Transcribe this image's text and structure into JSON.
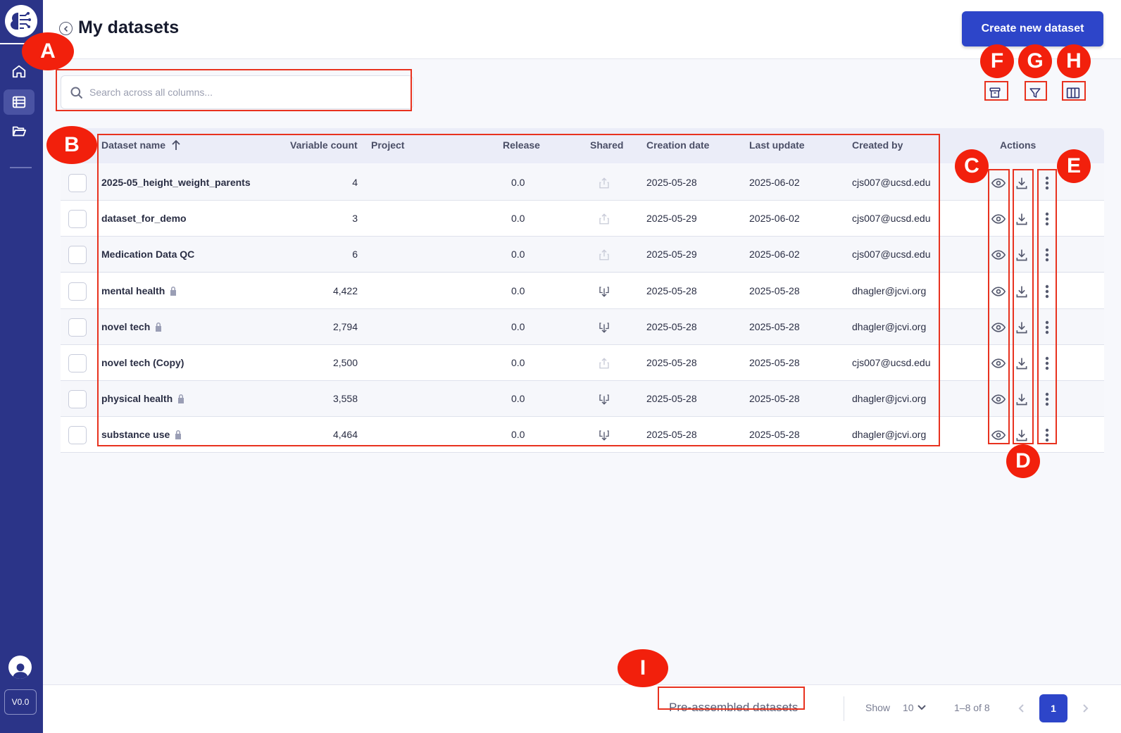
{
  "header": {
    "title": "My datasets",
    "create_label": "Create new dataset"
  },
  "sidebar": {
    "version": "V0.0"
  },
  "search": {
    "placeholder": "Search across all columns..."
  },
  "table": {
    "columns": [
      "Dataset name",
      "Variable count",
      "Project",
      "Release",
      "Shared",
      "Creation date",
      "Last update",
      "Created by",
      "Actions"
    ],
    "rows": [
      {
        "name": "2025-05_height_weight_parents",
        "locked": false,
        "count": "4",
        "project": "",
        "release": "0.0",
        "shared": "share",
        "created": "2025-05-28",
        "updated": "2025-06-02",
        "by": "cjs007@ucsd.edu"
      },
      {
        "name": "dataset_for_demo",
        "locked": false,
        "count": "3",
        "project": "",
        "release": "0.0",
        "shared": "share",
        "created": "2025-05-29",
        "updated": "2025-06-02",
        "by": "cjs007@ucsd.edu"
      },
      {
        "name": "Medication Data QC",
        "locked": false,
        "count": "6",
        "project": "",
        "release": "0.0",
        "shared": "share",
        "created": "2025-05-29",
        "updated": "2025-06-02",
        "by": "cjs007@ucsd.edu"
      },
      {
        "name": "mental health",
        "locked": true,
        "count": "4,422",
        "project": "",
        "release": "0.0",
        "shared": "received",
        "created": "2025-05-28",
        "updated": "2025-05-28",
        "by": "dhagler@jcvi.org"
      },
      {
        "name": "novel tech",
        "locked": true,
        "count": "2,794",
        "project": "",
        "release": "0.0",
        "shared": "received",
        "created": "2025-05-28",
        "updated": "2025-05-28",
        "by": "dhagler@jcvi.org"
      },
      {
        "name": "novel tech (Copy)",
        "locked": false,
        "count": "2,500",
        "project": "",
        "release": "0.0",
        "shared": "share",
        "created": "2025-05-28",
        "updated": "2025-05-28",
        "by": "cjs007@ucsd.edu"
      },
      {
        "name": "physical health",
        "locked": true,
        "count": "3,558",
        "project": "",
        "release": "0.0",
        "shared": "received",
        "created": "2025-05-28",
        "updated": "2025-05-28",
        "by": "dhagler@jcvi.org"
      },
      {
        "name": "substance use",
        "locked": true,
        "count": "4,464",
        "project": "",
        "release": "0.0",
        "shared": "received",
        "created": "2025-05-28",
        "updated": "2025-05-28",
        "by": "dhagler@jcvi.org"
      }
    ]
  },
  "footer": {
    "preassembled": "Pre-assembled datasets",
    "show_label": "Show",
    "page_size": "10",
    "range": "1–8 of 8",
    "current_page": "1"
  },
  "markers": [
    "A",
    "B",
    "C",
    "D",
    "E",
    "F",
    "G",
    "H",
    "I"
  ],
  "colors": {
    "sidebar": "#2b3488",
    "primary": "#2d45c9",
    "annotation": "#f2200c"
  }
}
